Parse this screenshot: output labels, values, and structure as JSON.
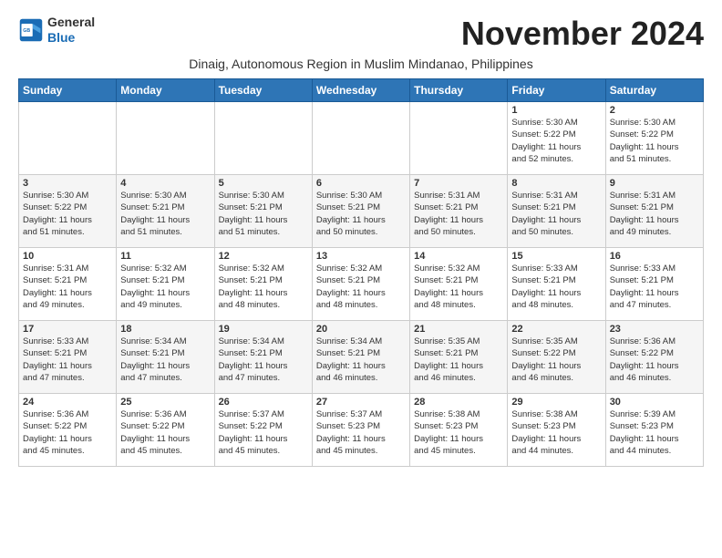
{
  "logo": {
    "line1": "General",
    "line2": "Blue"
  },
  "title": "November 2024",
  "subtitle": "Dinaig, Autonomous Region in Muslim Mindanao, Philippines",
  "headers": [
    "Sunday",
    "Monday",
    "Tuesday",
    "Wednesday",
    "Thursday",
    "Friday",
    "Saturday"
  ],
  "weeks": [
    [
      {
        "day": "",
        "info": ""
      },
      {
        "day": "",
        "info": ""
      },
      {
        "day": "",
        "info": ""
      },
      {
        "day": "",
        "info": ""
      },
      {
        "day": "",
        "info": ""
      },
      {
        "day": "1",
        "info": "Sunrise: 5:30 AM\nSunset: 5:22 PM\nDaylight: 11 hours\nand 52 minutes."
      },
      {
        "day": "2",
        "info": "Sunrise: 5:30 AM\nSunset: 5:22 PM\nDaylight: 11 hours\nand 51 minutes."
      }
    ],
    [
      {
        "day": "3",
        "info": "Sunrise: 5:30 AM\nSunset: 5:22 PM\nDaylight: 11 hours\nand 51 minutes."
      },
      {
        "day": "4",
        "info": "Sunrise: 5:30 AM\nSunset: 5:21 PM\nDaylight: 11 hours\nand 51 minutes."
      },
      {
        "day": "5",
        "info": "Sunrise: 5:30 AM\nSunset: 5:21 PM\nDaylight: 11 hours\nand 51 minutes."
      },
      {
        "day": "6",
        "info": "Sunrise: 5:30 AM\nSunset: 5:21 PM\nDaylight: 11 hours\nand 50 minutes."
      },
      {
        "day": "7",
        "info": "Sunrise: 5:31 AM\nSunset: 5:21 PM\nDaylight: 11 hours\nand 50 minutes."
      },
      {
        "day": "8",
        "info": "Sunrise: 5:31 AM\nSunset: 5:21 PM\nDaylight: 11 hours\nand 50 minutes."
      },
      {
        "day": "9",
        "info": "Sunrise: 5:31 AM\nSunset: 5:21 PM\nDaylight: 11 hours\nand 49 minutes."
      }
    ],
    [
      {
        "day": "10",
        "info": "Sunrise: 5:31 AM\nSunset: 5:21 PM\nDaylight: 11 hours\nand 49 minutes."
      },
      {
        "day": "11",
        "info": "Sunrise: 5:32 AM\nSunset: 5:21 PM\nDaylight: 11 hours\nand 49 minutes."
      },
      {
        "day": "12",
        "info": "Sunrise: 5:32 AM\nSunset: 5:21 PM\nDaylight: 11 hours\nand 48 minutes."
      },
      {
        "day": "13",
        "info": "Sunrise: 5:32 AM\nSunset: 5:21 PM\nDaylight: 11 hours\nand 48 minutes."
      },
      {
        "day": "14",
        "info": "Sunrise: 5:32 AM\nSunset: 5:21 PM\nDaylight: 11 hours\nand 48 minutes."
      },
      {
        "day": "15",
        "info": "Sunrise: 5:33 AM\nSunset: 5:21 PM\nDaylight: 11 hours\nand 48 minutes."
      },
      {
        "day": "16",
        "info": "Sunrise: 5:33 AM\nSunset: 5:21 PM\nDaylight: 11 hours\nand 47 minutes."
      }
    ],
    [
      {
        "day": "17",
        "info": "Sunrise: 5:33 AM\nSunset: 5:21 PM\nDaylight: 11 hours\nand 47 minutes."
      },
      {
        "day": "18",
        "info": "Sunrise: 5:34 AM\nSunset: 5:21 PM\nDaylight: 11 hours\nand 47 minutes."
      },
      {
        "day": "19",
        "info": "Sunrise: 5:34 AM\nSunset: 5:21 PM\nDaylight: 11 hours\nand 47 minutes."
      },
      {
        "day": "20",
        "info": "Sunrise: 5:34 AM\nSunset: 5:21 PM\nDaylight: 11 hours\nand 46 minutes."
      },
      {
        "day": "21",
        "info": "Sunrise: 5:35 AM\nSunset: 5:21 PM\nDaylight: 11 hours\nand 46 minutes."
      },
      {
        "day": "22",
        "info": "Sunrise: 5:35 AM\nSunset: 5:22 PM\nDaylight: 11 hours\nand 46 minutes."
      },
      {
        "day": "23",
        "info": "Sunrise: 5:36 AM\nSunset: 5:22 PM\nDaylight: 11 hours\nand 46 minutes."
      }
    ],
    [
      {
        "day": "24",
        "info": "Sunrise: 5:36 AM\nSunset: 5:22 PM\nDaylight: 11 hours\nand 45 minutes."
      },
      {
        "day": "25",
        "info": "Sunrise: 5:36 AM\nSunset: 5:22 PM\nDaylight: 11 hours\nand 45 minutes."
      },
      {
        "day": "26",
        "info": "Sunrise: 5:37 AM\nSunset: 5:22 PM\nDaylight: 11 hours\nand 45 minutes."
      },
      {
        "day": "27",
        "info": "Sunrise: 5:37 AM\nSunset: 5:23 PM\nDaylight: 11 hours\nand 45 minutes."
      },
      {
        "day": "28",
        "info": "Sunrise: 5:38 AM\nSunset: 5:23 PM\nDaylight: 11 hours\nand 45 minutes."
      },
      {
        "day": "29",
        "info": "Sunrise: 5:38 AM\nSunset: 5:23 PM\nDaylight: 11 hours\nand 44 minutes."
      },
      {
        "day": "30",
        "info": "Sunrise: 5:39 AM\nSunset: 5:23 PM\nDaylight: 11 hours\nand 44 minutes."
      }
    ]
  ]
}
